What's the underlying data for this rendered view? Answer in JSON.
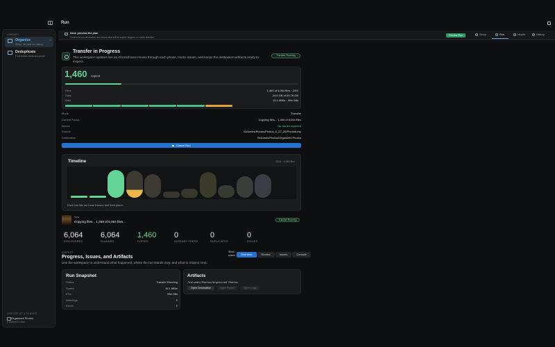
{
  "window": {
    "title": "Run"
  },
  "sidebar": {
    "section_label": "LIBRARY",
    "items": [
      {
        "label": "Organize",
        "subtitle": "Setup, run, and run history",
        "badge": "1"
      },
      {
        "label": "Deduplicate",
        "subtitle": "Find similar shots and prune"
      }
    ],
    "footer": {
      "heading": "LIBRARY AT A GLANCE",
      "name": "Organized Photos",
      "stats": "0 archived    0 new"
    }
  },
  "topbar": {
    "hint_title": "Next: preview the plan",
    "hint_subtitle": "Preview is non-destructive and shows what will be copied, skipped, or needs attention.",
    "preview_button": "Preview Plan",
    "tabs": [
      {
        "label": "Setup",
        "icon": "setup-icon"
      },
      {
        "label": "Run",
        "icon": "run-icon"
      },
      {
        "label": "Health",
        "icon": "health-icon"
      },
      {
        "label": "History",
        "icon": "history-icon"
      }
    ],
    "active_tab": "Run"
  },
  "header": {
    "title": "Transfer in Progress",
    "description": "This workspace updates live as Chronoframe moves through each phase, tracks issues, and keeps the destination artifacts ready to inspect.",
    "status_pill": "Transfer Running"
  },
  "progress": {
    "copied": "1,460",
    "copied_label": "copied",
    "fraction": 0.241,
    "rows": [
      {
        "key": "Files",
        "value": "1,460 of 6,064 files · 24%"
      },
      {
        "key": "Data",
        "value": "24.6 GB of 65.78 GB"
      },
      {
        "key": "Rate",
        "value": "15.1 MB/s · 49m 58s"
      }
    ],
    "phase_colors": [
      "#4fbf86",
      "#4fbf86",
      "#4fbf86",
      "#4fbf86",
      "#4fbf86",
      "#e3a33c"
    ]
  },
  "meta_rows": [
    {
      "key": "Mode",
      "value": "Transfer",
      "ok": false
    },
    {
      "key": "Current Focus",
      "value": "Copying files... 1,460 of 6,064 files",
      "ok": false
    },
    {
      "key": "Issues",
      "value": "No issues reported",
      "ok": true
    },
    {
      "key": "Source",
      "value": "/Volumes/Photos/Photos_6_27_26/Photodump",
      "ok": false
    },
    {
      "key": "Destination",
      "value": "/Volumes/Photos/Organized Photos",
      "ok": false
    }
  ],
  "cancel_button": "Cancel Run",
  "timeline": {
    "title": "Timeline",
    "meta": "2014 · 6,064 files",
    "caption": "Each bar fills as those frames find their place.",
    "bars": [
      {
        "colors": [
          "#63d396"
        ],
        "level": 0.08
      },
      {
        "colors": [
          "#63d396"
        ],
        "level": 0.08
      },
      {
        "colors": [
          "#63d396"
        ],
        "level": 0.92
      },
      {
        "colors": [
          "#e9b74a",
          "#3c3a33"
        ],
        "level": 0.9
      },
      {
        "colors": [
          "#3c3a33"
        ],
        "level": 0.78
      },
      {
        "colors": [
          "#37372f"
        ],
        "level": 0.22
      },
      {
        "colors": [
          "#37372f"
        ],
        "level": 0.3
      },
      {
        "colors": [
          "#3b3b2c"
        ],
        "level": 0.85
      },
      {
        "colors": [
          "#363b33"
        ],
        "level": 0.42
      },
      {
        "colors": [
          "#3a3e3a"
        ],
        "level": 0.72
      },
      {
        "colors": [
          "#3a3e44"
        ],
        "level": 0.78
      }
    ]
  },
  "now": {
    "label": "Now",
    "text": "Copying files... 1,460 of 6,064 files...",
    "pill": "Transfer Running"
  },
  "stats": [
    {
      "value": "6,064",
      "label": "DISCOVERED",
      "green": false
    },
    {
      "value": "6,064",
      "label": "PLANNED",
      "green": false
    },
    {
      "value": "1,460",
      "label": "COPIED",
      "green": true
    },
    {
      "value": "0",
      "label": "ALREADY THERE",
      "green": false
    },
    {
      "value": "0",
      "label": "DUPLICATES",
      "green": false
    },
    {
      "value": "0",
      "label": "ISSUES",
      "green": false
    }
  ],
  "inspect": {
    "kicker": "INSPECT",
    "title": "Progress, Issues, and Artifacts",
    "description": "Use the workspace to understand what happened, where the run stands now, and what to inspect next.",
    "workspace_label": "Work-space",
    "tabs": [
      "Overview",
      "Review",
      "Issues",
      "Console"
    ],
    "active": "Overview"
  },
  "snapshot": {
    "title": "Run Snapshot",
    "rows": [
      {
        "key": "Status",
        "value": "Transfer Running"
      },
      {
        "key": "Speed",
        "value": "15.1 MB/s"
      },
      {
        "key": "ETA",
        "value": "49m 58s"
      },
      {
        "key": "Warnings",
        "value": "0"
      },
      {
        "key": "Errors",
        "value": "0"
      }
    ]
  },
  "artifacts": {
    "title": "Artifacts",
    "path": "/Volumes/Photos/Organized Photos",
    "buttons": [
      {
        "label": "Open Destination",
        "enabled": true
      },
      {
        "label": "Open Report",
        "enabled": false
      },
      {
        "label": "Open Logs",
        "enabled": false
      }
    ]
  }
}
